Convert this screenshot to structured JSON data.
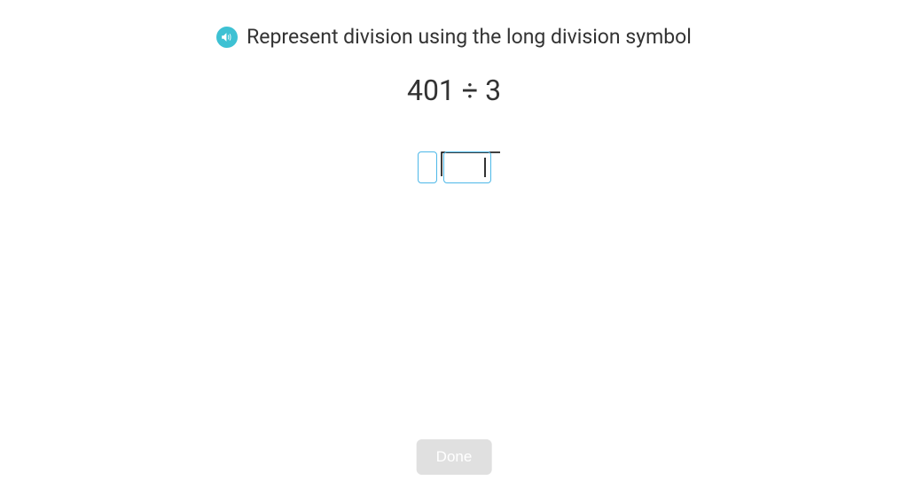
{
  "instruction": "Represent division using the long division symbol",
  "problem": "401 ÷ 3",
  "divisor_value": "",
  "dividend_value": "",
  "done_label": "Done",
  "icons": {
    "sound": "sound-icon"
  }
}
